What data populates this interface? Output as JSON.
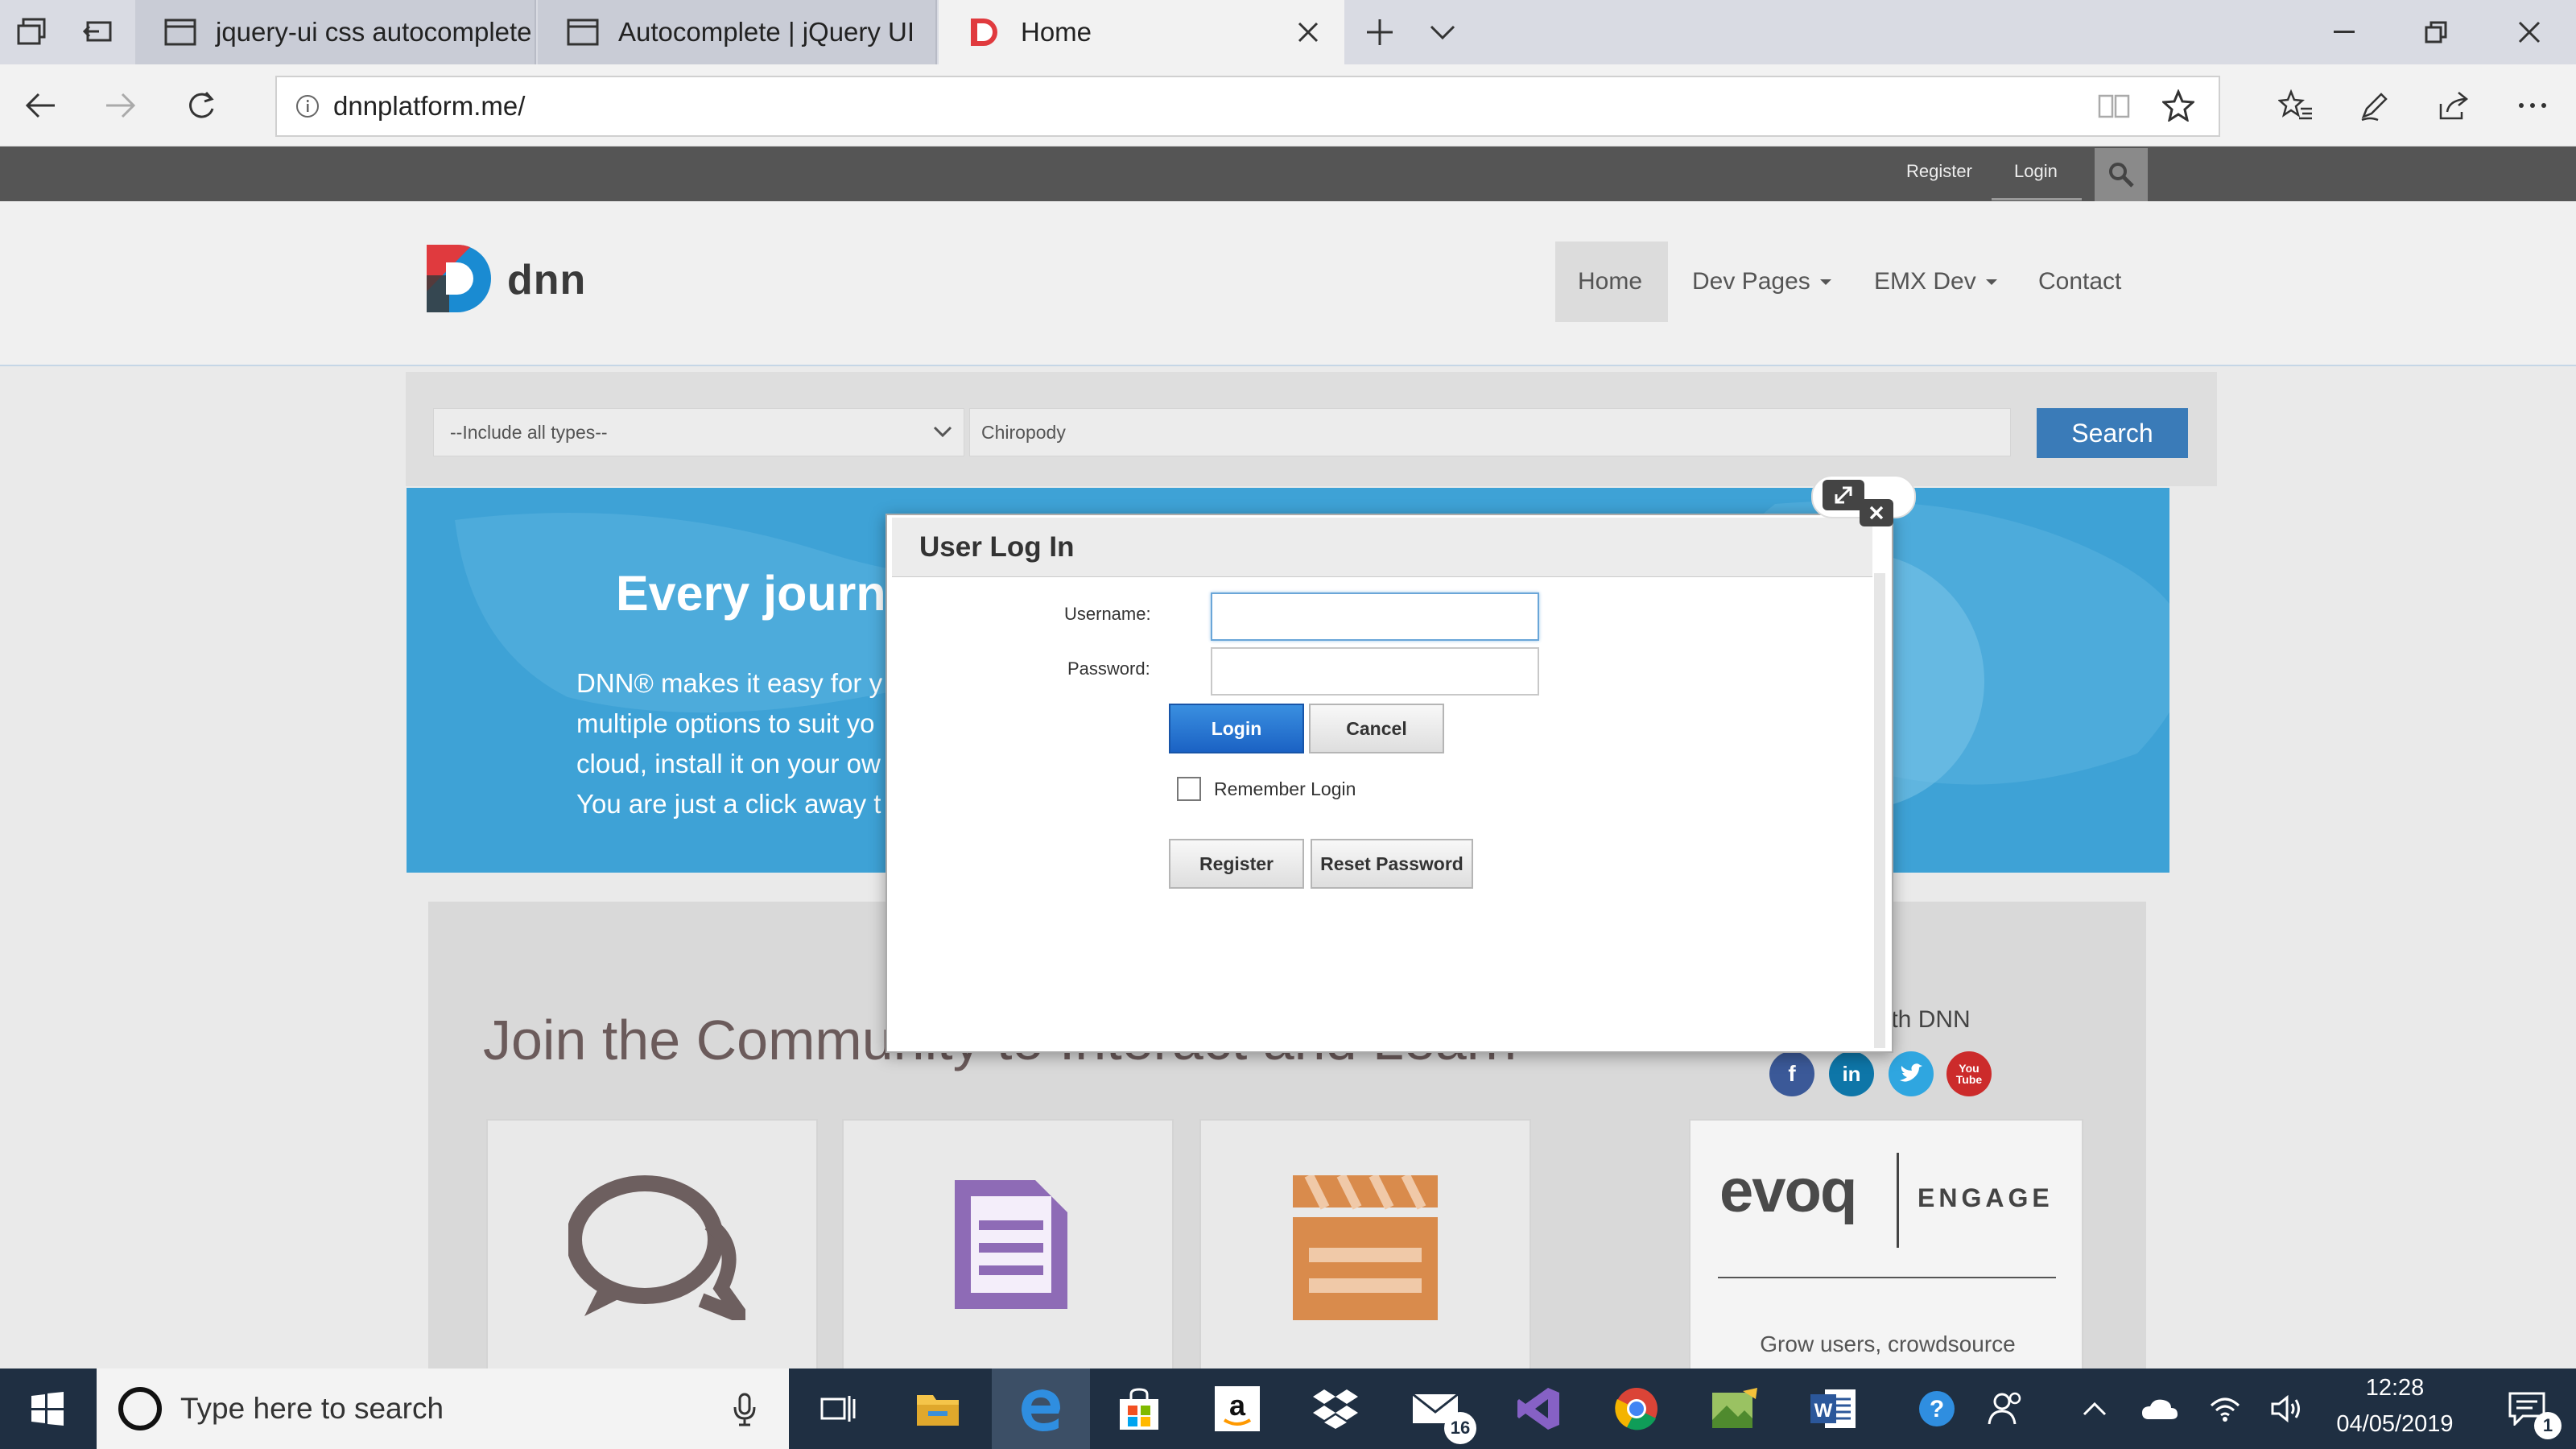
{
  "browser": {
    "tabs": [
      {
        "title": "jquery-ui css autocomplete"
      },
      {
        "title": "Autocomplete | jQuery UI"
      },
      {
        "title": "Home"
      }
    ],
    "address": "dnnplatform.me/"
  },
  "site": {
    "topbar": {
      "register": "Register",
      "login": "Login"
    },
    "logo_text": "dnn",
    "menu": [
      {
        "label": "Home"
      },
      {
        "label": "Dev Pages"
      },
      {
        "label": "EMX Dev"
      },
      {
        "label": "Contact"
      }
    ],
    "search": {
      "type_select": "--Include all types--",
      "keyword": "Chiropody",
      "button": "Search"
    },
    "hero": {
      "title": "Every journ",
      "lines": [
        "DNN® makes it easy for y",
        "multiple options to suit yo",
        "cloud, install it on your ow",
        "You are just a click away t"
      ]
    },
    "community": {
      "title": "Join the Community to Interact and Learn",
      "social_label": "h with DNN",
      "evoq_logo": "evoq",
      "evoq_product": "ENGAGE",
      "evoq_tagline": "Grow users, crowdsource"
    }
  },
  "dialog": {
    "title": "User Log In",
    "username_label": "Username:",
    "password_label": "Password:",
    "login_button": "Login",
    "cancel_button": "Cancel",
    "remember_label": "Remember Login",
    "register_button": "Register",
    "reset_button": "Reset Password"
  },
  "taskbar": {
    "search_placeholder": "Type here to search",
    "mail_badge": "16",
    "time": "12:28",
    "date": "04/05/2019",
    "notification_count": "1"
  }
}
